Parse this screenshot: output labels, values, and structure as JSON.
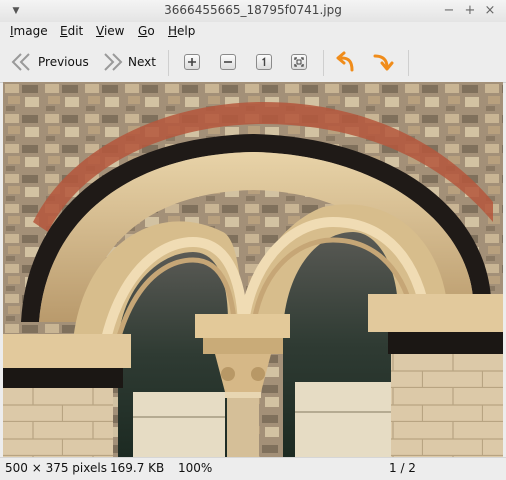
{
  "window": {
    "title": "3666455665_18795f0741.jpg"
  },
  "menubar": {
    "items": [
      {
        "label": "Image",
        "mnemonic": "I",
        "rest": "mage"
      },
      {
        "label": "Edit",
        "mnemonic": "E",
        "rest": "dit"
      },
      {
        "label": "View",
        "mnemonic": "V",
        "rest": "iew"
      },
      {
        "label": "Go",
        "mnemonic": "G",
        "rest": "o"
      },
      {
        "label": "Help",
        "mnemonic": "H",
        "rest": "elp"
      }
    ]
  },
  "toolbar": {
    "previous_label": "Previous",
    "next_label": "Next",
    "icons": [
      "chevron-left-icon",
      "chevron-right-icon",
      "zoom-in-icon",
      "zoom-out-icon",
      "zoom-normal-icon",
      "zoom-fit-icon",
      "rotate-left-icon",
      "rotate-right-icon"
    ],
    "accent_color": "#f08c1a"
  },
  "statusbar": {
    "dimensions": "500 × 375 pixels",
    "filesize": "169.7 KB",
    "zoom": "100%",
    "position": "1 / 2"
  }
}
